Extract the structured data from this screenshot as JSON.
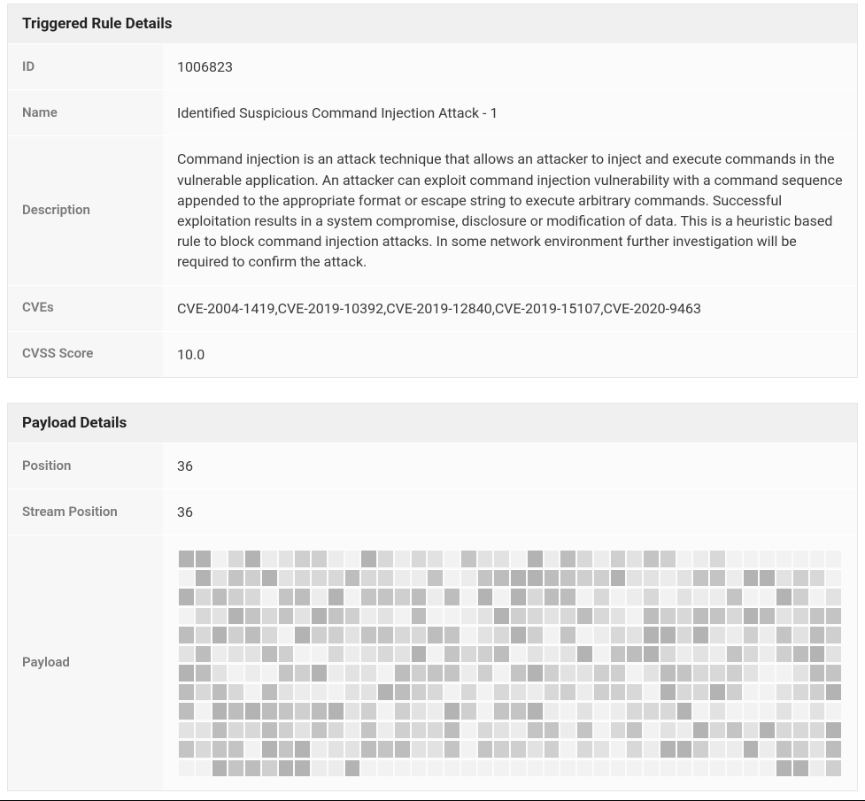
{
  "triggered_rule": {
    "title": "Triggered Rule Details",
    "labels": {
      "id": "ID",
      "name": "Name",
      "description": "Description",
      "cves": "CVEs",
      "cvss_score": "CVSS Score"
    },
    "values": {
      "id": "1006823",
      "name": "Identified Suspicious Command Injection Attack - 1",
      "description": "Command injection is an attack technique that allows an attacker to inject and execute commands in the vulnerable application. An attacker can exploit command injection vulnerability with a command sequence appended to the appropriate format or escape string to execute arbitrary commands. Successful exploitation results in a system compromise, disclosure or modification of data. This is a heuristic based rule to block command injection attacks. In some network environment further investigation will be required to confirm the attack.",
      "cves": "CVE-2004-1419,CVE-2019-10392,CVE-2019-12840,CVE-2019-15107,CVE-2020-9463",
      "cvss_score": "10.0"
    }
  },
  "payload": {
    "title": "Payload Details",
    "labels": {
      "position": "Position",
      "stream_position": "Stream Position",
      "payload": "Payload"
    },
    "values": {
      "position": "36",
      "stream_position": "36"
    }
  }
}
